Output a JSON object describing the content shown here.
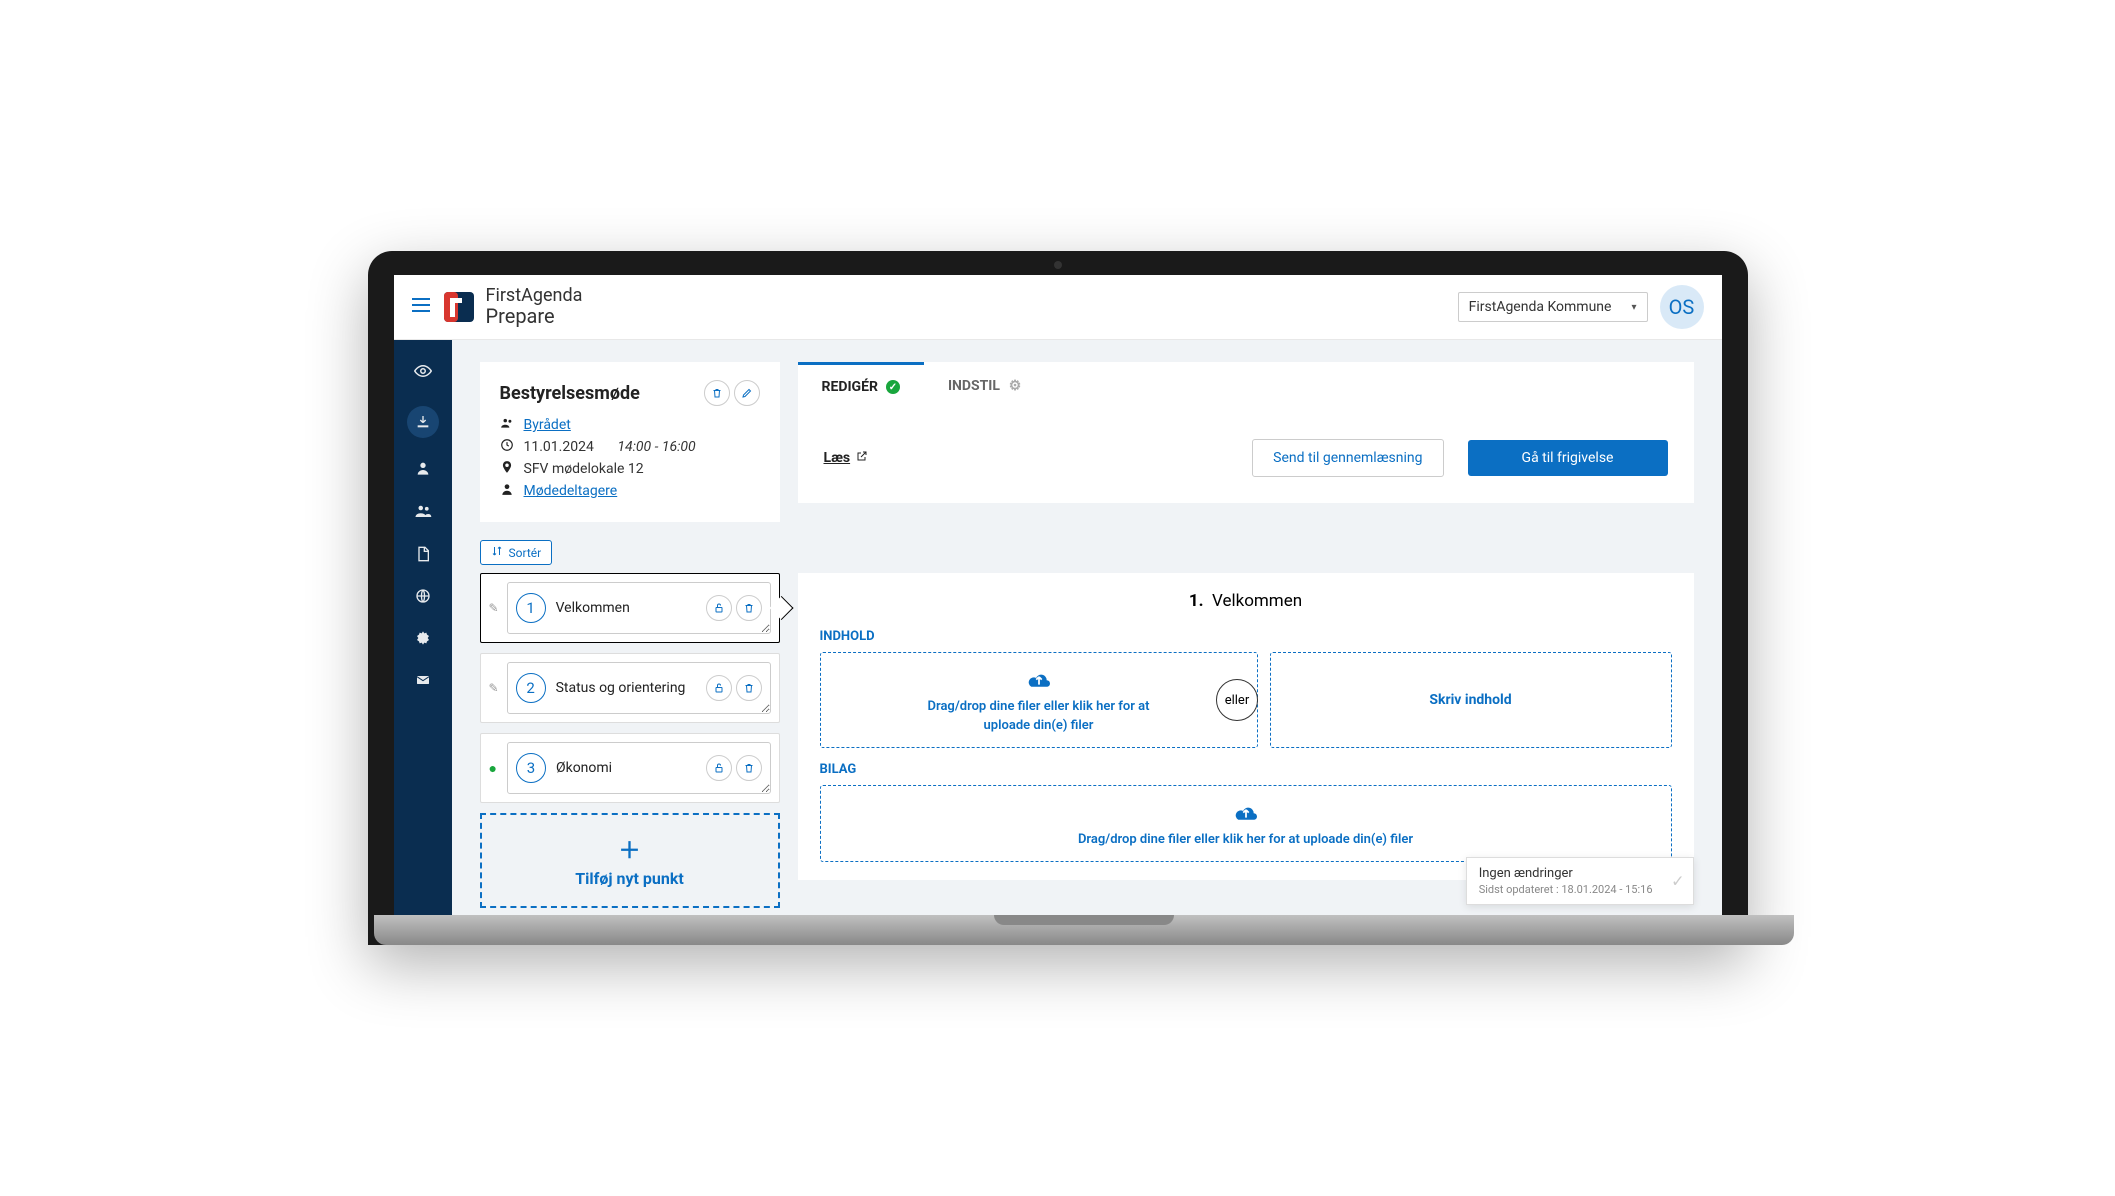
{
  "header": {
    "product_line1": "FirstAgenda",
    "product_line2": "Prepare",
    "org_selected": "FirstAgenda Kommune",
    "avatar_initials": "OS"
  },
  "meeting": {
    "title": "Bestyrelsesmøde",
    "committee": "Byrådet",
    "date": "11.01.2024",
    "time": "14:00 - 16:00",
    "location": "SFV mødelokale 12",
    "participants_link": "Mødedeltagere"
  },
  "tabs": {
    "edit": "REDIGÉR",
    "settings": "INDSTIL",
    "read_label": "Læs",
    "send_review": "Send til gennemlæsning",
    "go_release": "Gå til frigivelse"
  },
  "sort_label": "Sortér",
  "agenda": [
    {
      "num": "1",
      "title": "Velkommen",
      "status": "none",
      "selected": true
    },
    {
      "num": "2",
      "title": "Status og orientering",
      "status": "none",
      "selected": false
    },
    {
      "num": "3",
      "title": "Økonomi",
      "status": "done",
      "selected": false
    }
  ],
  "add_item_label": "Tilføj nyt punkt",
  "detail": {
    "current_num": "1.",
    "current_title": "Velkommen",
    "section_content": "INDHOLD",
    "section_attachments": "BILAG",
    "drop_line1": "Drag/drop dine filer eller klik her for at",
    "drop_line2": "uploade din(e) filer",
    "drop_attachments": "Drag/drop dine filer eller klik her for at uploade din(e) filer",
    "or_label": "eller",
    "write_content": "Skriv indhold"
  },
  "toast": {
    "title": "Ingen ændringer",
    "subtitle": "Sidst opdateret : 18.01.2024 - 15:16"
  }
}
